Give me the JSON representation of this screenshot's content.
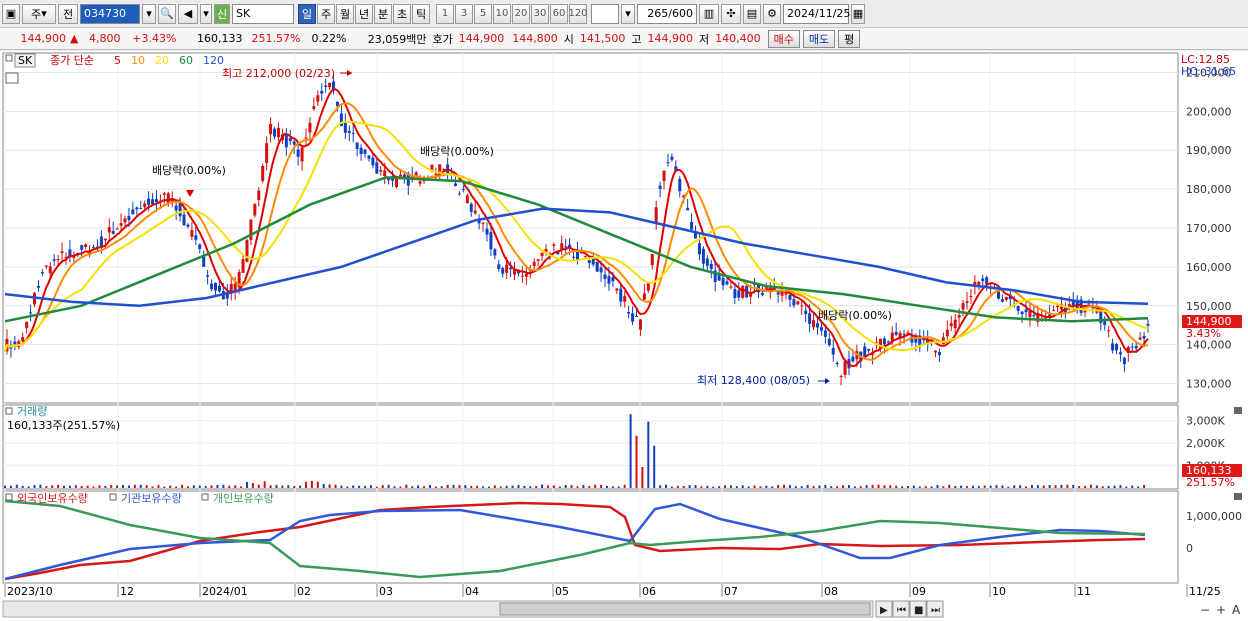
{
  "toolbar": {
    "type_label": "주",
    "prev_label": "전",
    "code": "034730",
    "badge": "신",
    "name": "SK",
    "periods": [
      "일",
      "주",
      "월",
      "년",
      "분",
      "초",
      "틱"
    ],
    "active_period": "일",
    "intervals": [
      "1",
      "3",
      "5",
      "10",
      "20",
      "30",
      "60",
      "120"
    ],
    "count": "265",
    "count_max": "/600",
    "date": "2024/11/25"
  },
  "quote": {
    "price": "144,900",
    "change": "4,800",
    "change_pct": "+3.43%",
    "volume": "160,133",
    "volume_ratio": "251.57%",
    "turnover_ratio": "0.22%",
    "amount": "23,059백만",
    "hoga_label": "호가",
    "hoga_ask": "144,900",
    "hoga_bid": "144,800",
    "open_label": "시",
    "open": "141,500",
    "high_label": "고",
    "high": "144,900",
    "low_label": "저",
    "low": "140,400",
    "buy_label": "매수",
    "sell_label": "매도",
    "eval_label": "평"
  },
  "legend": {
    "name": "SK",
    "title": "종가 단순",
    "ma": [
      {
        "label": "5",
        "color": "#e00000"
      },
      {
        "label": "10",
        "color": "#ff8c00"
      },
      {
        "label": "20",
        "color": "#f5e100"
      },
      {
        "label": "60",
        "color": "#1e8c3c"
      },
      {
        "label": "120",
        "color": "#2050d0"
      }
    ]
  },
  "annotations": {
    "high": "최고 212,000 (02/23)",
    "low": "최저 128,400 (08/05)",
    "div1": "배당락(0.00%)",
    "div2": "배당락(0.00%)",
    "div3": "배당락(0.00%)",
    "lc": "LC:12.85",
    "hc": "HC:-31.65",
    "price_tag": "144,900",
    "pct_tag": "3.43%"
  },
  "price_axis": [
    "210,000",
    "200,000",
    "190,000",
    "180,000",
    "170,000",
    "160,000",
    "150,000",
    "140,000",
    "130,000"
  ],
  "volume_panel": {
    "title": "거래량",
    "value": "160,133주(251.57%)",
    "axis": [
      "3,000K",
      "2,000K",
      "1,000K"
    ],
    "tag": "160,133",
    "tag_pct": "251.57%"
  },
  "holding_panel": {
    "series": [
      "외국인보유수량",
      "기관보유수량",
      "개인보유수량"
    ],
    "colors": [
      "#d81818",
      "#3058d8",
      "#3a9a5a"
    ],
    "axis": [
      "1,000,000",
      "0"
    ]
  },
  "x_axis": [
    "2023/10",
    "12",
    "2024/01",
    "02",
    "03",
    "04",
    "05",
    "06",
    "07",
    "08",
    "09",
    "10",
    "11",
    "11/25"
  ],
  "colors": {
    "up": "#d21010",
    "down": "#1040c0",
    "ma5": "#e00000",
    "ma10": "#ff8c00",
    "ma20": "#f5e100",
    "ma60": "#1e8c3c",
    "ma120": "#2050d0"
  },
  "chart_data": {
    "type": "line",
    "title": "",
    "x": [
      "2023/10",
      "12",
      "2024/01",
      "02",
      "03",
      "04",
      "05",
      "06",
      "07",
      "08",
      "09",
      "10",
      "11",
      "11/25"
    ],
    "series": [
      {
        "name": "SK",
        "values": [
          140000,
          158000,
          165000,
          172000,
          176000,
          198000,
          183000,
          184000,
          173000,
          158000,
          162000,
          150000,
          183000,
          160000,
          154000,
          152000,
          135000,
          140000,
          148000,
          157000,
          152000,
          150000,
          148000,
          149000,
          141000,
          144900
        ]
      },
      {
        "name": "120",
        "values": [
          153000,
          151000,
          150000,
          152000,
          156000,
          160000,
          166000,
          172000,
          175000,
          174000,
          170000,
          166000,
          163000,
          160000,
          156000,
          154000,
          151000,
          150500
        ]
      },
      {
        "name": "60",
        "values": [
          146000,
          150000,
          158000,
          166000,
          176000,
          183000,
          182000,
          176000,
          168000,
          160000,
          155000,
          153000,
          150000,
          147000,
          146000,
          146800
        ]
      }
    ],
    "ylim": [
      125000,
      215000
    ]
  }
}
